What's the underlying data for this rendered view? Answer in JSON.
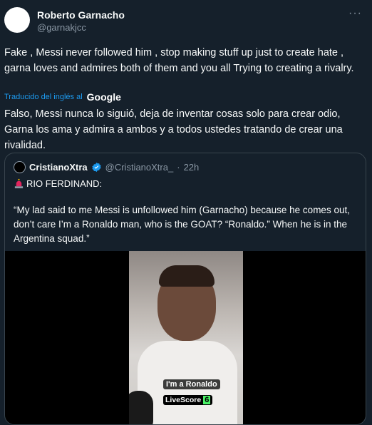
{
  "author": {
    "name": "Roberto Garnacho",
    "handle": "@garnakjcc",
    "more_icon": "more-horizontal-icon"
  },
  "tweet": {
    "text": "Fake , Messi never followed him , stop making stuff up just to create hate , garna loves and admires both of them and you all Trying to creating a rivalry.",
    "translated_by": "Traducido del inglés al",
    "translator": "Google",
    "translation": "Falso, Messi nunca lo siguió, deja de inventar cosas solo para crear odio, Garna los ama y admira a ambos y a todos ustedes tratando de crear una rivalidad."
  },
  "quote": {
    "name": "CristianoXtra",
    "handle": "@CristianoXtra_",
    "separator": "·",
    "time": "22h",
    "headline": "RIO FERDINAND:",
    "body": "“My lad said to me Messi is unfollowed him (Garnacho) because he comes out, don’t care I’m a Ronaldo man, who is the GOAT? “Ronaldo.” When he is in the Argentina squad.”",
    "video": {
      "subtitle": "I'm a Ronaldo",
      "brand": "LiveScore",
      "brand_badge": "6"
    }
  },
  "colors": {
    "background": "#15202b",
    "text": "#f7f9f9",
    "secondary": "#8b98a5",
    "accent": "#1d9bf0",
    "border": "#38444d"
  }
}
